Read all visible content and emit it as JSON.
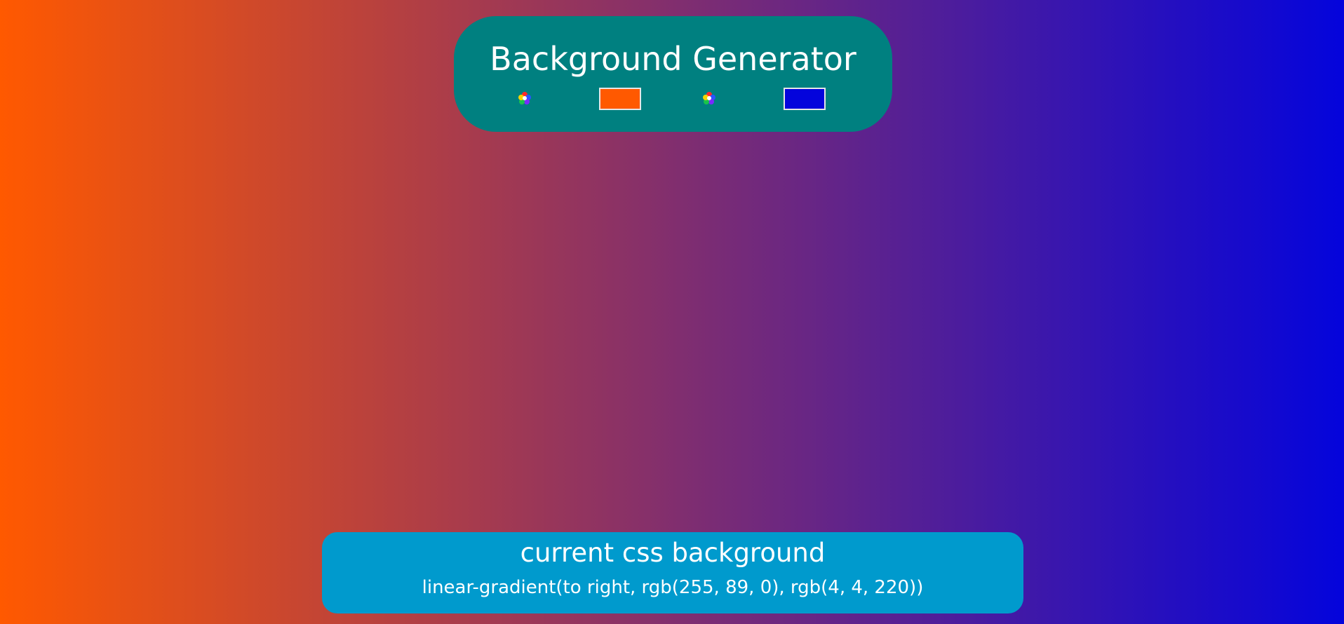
{
  "header": {
    "title": "Background Generator"
  },
  "color_inputs": [
    {
      "icon": "color-wheel-icon",
      "value": "#ff5900"
    },
    {
      "icon": "color-wheel-icon",
      "value": "#0404dc"
    }
  ],
  "footer": {
    "title": "current css background",
    "value": "linear-gradient(to right, rgb(255, 89, 0), rgb(4, 4, 220))"
  },
  "colors": {
    "header_bg": "#008080",
    "footer_bg": "#009acd",
    "text": "#ffffff"
  }
}
